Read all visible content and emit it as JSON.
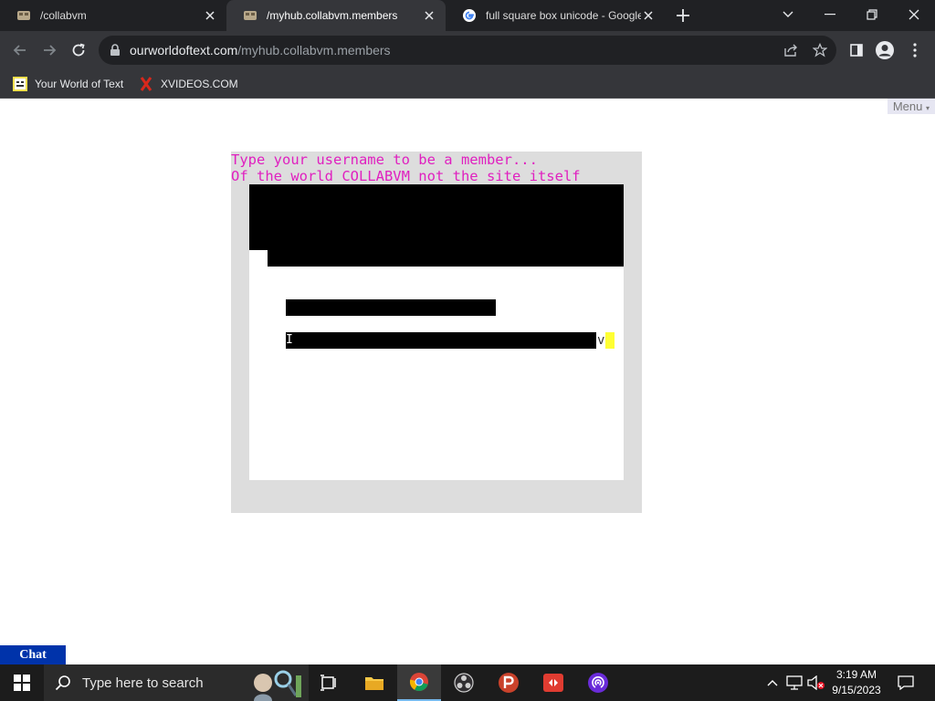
{
  "browser": {
    "tabs": [
      {
        "title": "/collabvm",
        "active": false
      },
      {
        "title": "/myhub.collabvm.members",
        "active": true
      },
      {
        "title": "full square box unicode - Google",
        "active": false
      }
    ],
    "url": {
      "host": "ourworldoftext.com",
      "path": "/myhub.collabvm.members"
    },
    "bookmarks": [
      {
        "label": "Your World of Text",
        "icon": "ywot-icon"
      },
      {
        "label": "XVIDEOS.COM",
        "icon": "x-logo-icon"
      }
    ]
  },
  "page": {
    "menu_label": "Menu",
    "menu_caret": "▾",
    "lines": [
      "Type your username to be a member...",
      "Of the world COLLABVM not the site itself"
    ],
    "trailing_char": "v",
    "cursor_glyph": "I",
    "chat_label": "Chat"
  },
  "taskbar": {
    "search_placeholder": "Type here to search",
    "time": "3:19 AM",
    "date": "9/15/2023"
  },
  "colors": {
    "text_magenta": "#e020c0",
    "world_gray": "#dddddd",
    "chat_blue": "#0033aa",
    "highlight_yellow": "#ffff33"
  }
}
